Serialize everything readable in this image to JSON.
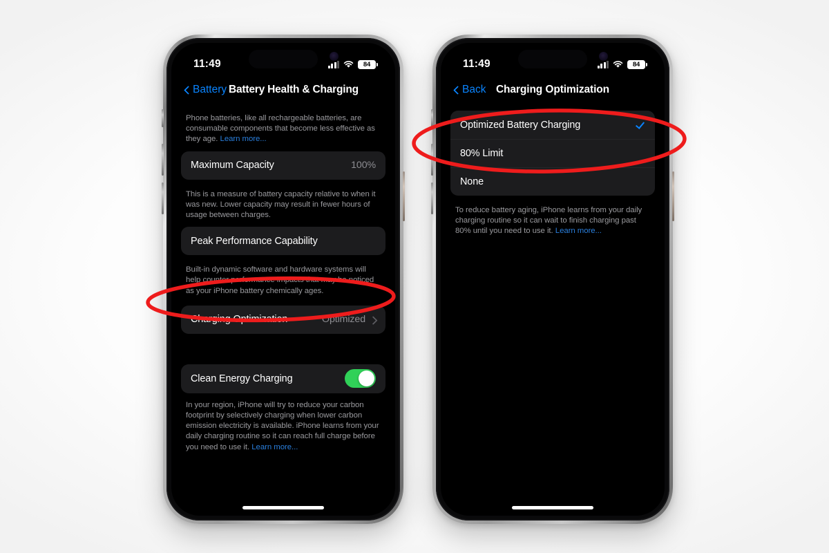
{
  "meta": {
    "background": "#ffffff",
    "accent_blue": "#0a84ff",
    "link_blue": "#2a7fdd",
    "toggle_green": "#30d158",
    "annotation_red": "#ee1c1c",
    "group_bg": "#1c1c1e"
  },
  "phone_left": {
    "status": {
      "time": "11:49",
      "signal_icon": "cellular-bars-icon",
      "wifi_icon": "wifi-icon",
      "battery_level": "84",
      "battery_icon": "battery-icon"
    },
    "nav": {
      "back_icon": "chevron-left-icon",
      "back_label": "Battery",
      "title": "Battery Health & Charging"
    },
    "intro_text": "Phone batteries, like all rechargeable batteries, are consumable components that become less effective as they age. ",
    "intro_link": "Learn more...",
    "rows": {
      "maximum_capacity_label": "Maximum Capacity",
      "maximum_capacity_value": "100%",
      "capacity_footnote": "This is a measure of battery capacity relative to when it was new. Lower capacity may result in fewer hours of usage between charges.",
      "peak_performance_label": "Peak Performance Capability",
      "peak_footnote": "Built-in dynamic software and hardware systems will help counter performance impacts that may be noticed as your iPhone battery chemically ages.",
      "charging_optimization_label": "Charging Optimization",
      "charging_optimization_value": "Optimized",
      "charging_optimization_chevron": "chevron-right-icon",
      "clean_energy_label": "Clean Energy Charging",
      "clean_energy_toggle": "on",
      "clean_energy_footnote": "In your region, iPhone will try to reduce your carbon footprint by selectively charging when lower carbon emission electricity is available. iPhone learns from your daily charging routine so it can reach full charge before you need to use it. ",
      "clean_energy_link": "Learn more..."
    }
  },
  "phone_right": {
    "status": {
      "time": "11:49",
      "signal_icon": "cellular-bars-icon",
      "wifi_icon": "wifi-icon",
      "battery_level": "84",
      "battery_icon": "battery-icon"
    },
    "nav": {
      "back_icon": "chevron-left-icon",
      "back_label": "Back",
      "title": "Charging Optimization"
    },
    "options": [
      {
        "label": "Optimized Battery Charging",
        "selected": true
      },
      {
        "label": "80% Limit",
        "selected": false
      },
      {
        "label": "None",
        "selected": false
      }
    ],
    "option_labels": {
      "optimized": "Optimized Battery Charging",
      "limit80": "80% Limit",
      "none": "None"
    },
    "footnote_text": "To reduce battery aging, iPhone learns from your daily charging routine so it can wait to finish charging past 80% until you need to use it. ",
    "footnote_link": "Learn more..."
  },
  "annotations": [
    {
      "name": "highlight-charging-optimization-row",
      "shape": "ellipse"
    },
    {
      "name": "highlight-charging-options",
      "shape": "ellipse"
    }
  ]
}
